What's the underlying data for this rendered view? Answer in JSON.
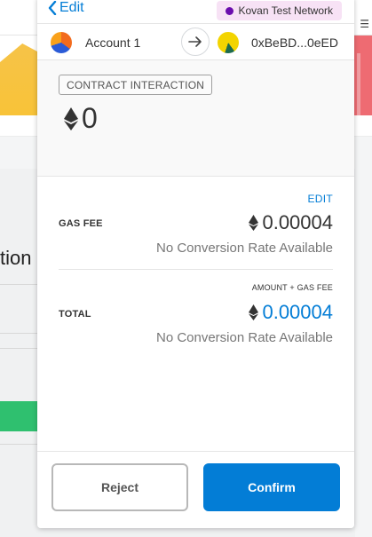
{
  "background": {
    "partial_text": "tion",
    "menu_glyph": "☰"
  },
  "header": {
    "back_label": "Edit",
    "network_label": "Kovan Test Network",
    "network_color": "#6a0dad"
  },
  "accounts": {
    "from_name": "Account 1",
    "to_address": "0xBeBD...0eED"
  },
  "summary": {
    "action_tag": "CONTRACT INTERACTION",
    "value": "0"
  },
  "details": {
    "edit_label": "EDIT",
    "gas_fee_label": "GAS FEE",
    "gas_fee_amount": "0.00004",
    "gas_fee_conversion": "No Conversion Rate Available",
    "amount_plus_gas_label": "AMOUNT + GAS FEE",
    "total_label": "TOTAL",
    "total_amount": "0.00004",
    "total_conversion": "No Conversion Rate Available"
  },
  "footer": {
    "reject_label": "Reject",
    "confirm_label": "Confirm"
  },
  "colors": {
    "accent": "#037dd6",
    "network_badge_bg": "#f7e2f5"
  }
}
